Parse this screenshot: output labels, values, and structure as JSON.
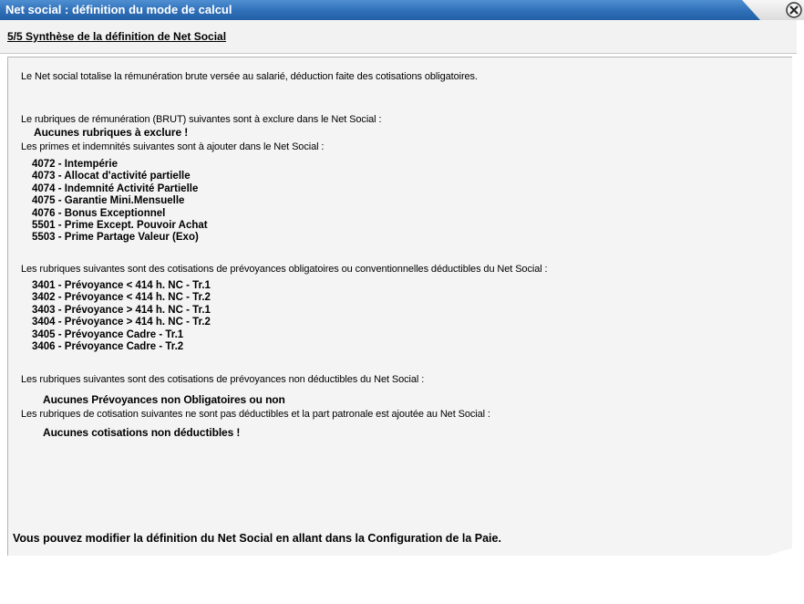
{
  "window": {
    "title": "Net social : définition du mode de calcul"
  },
  "step": {
    "title": "5/5 Synthèse de la définition de Net Social"
  },
  "content": {
    "intro": "Le Net social totalise la rémunération brute versée au salarié, déduction faite des cotisations obligatoires.",
    "section1": {
      "label": "Le rubriques de rémunération (BRUT) suivantes sont à exclure dans le Net Social :",
      "value": "Aucunes rubriques à exclure !"
    },
    "section2": {
      "label": "Les primes et indemnités suivantes sont à ajouter dans le Net Social :",
      "items": [
        "4072 - Intempérie",
        "4073 - Allocat d'activité partielle",
        "4074 - Indemnité Activité Partielle",
        "4075 - Garantie Mini.Mensuelle",
        "4076 - Bonus Exceptionnel",
        "5501 - Prime Except. Pouvoir Achat",
        "5503 - Prime Partage Valeur (Exo)"
      ]
    },
    "section3": {
      "label": "Les rubriques suivantes sont des cotisations de prévoyances obligatoires ou conventionnelles déductibles du Net Social :",
      "items": [
        "3401 - Prévoyance < 414 h. NC - Tr.1",
        "3402 - Prévoyance < 414 h. NC - Tr.2",
        "3403 - Prévoyance > 414 h. NC - Tr.1",
        "3404 - Prévoyance > 414 h. NC - Tr.2",
        "3405 - Prévoyance Cadre - Tr.1",
        "3406 - Prévoyance Cadre - Tr.2"
      ]
    },
    "section4": {
      "label": "Les rubriques suivantes sont des cotisations de prévoyances non déductibles du Net Social :",
      "value": "Aucunes Prévoyances non Obligatoires ou non"
    },
    "section5": {
      "label": "Les rubriques de cotisation suivantes ne sont pas déductibles et la part patronale est ajoutée au Net Social :",
      "value": "Aucunes cotisations non déductibles !"
    },
    "footer": "Vous pouvez modifier la définition du Net Social en allant dans la Configuration de la Paie."
  },
  "icons": {
    "close": "close-icon"
  },
  "colors": {
    "titlebar": "#2f6fb8",
    "title_text": "#ffffff"
  }
}
